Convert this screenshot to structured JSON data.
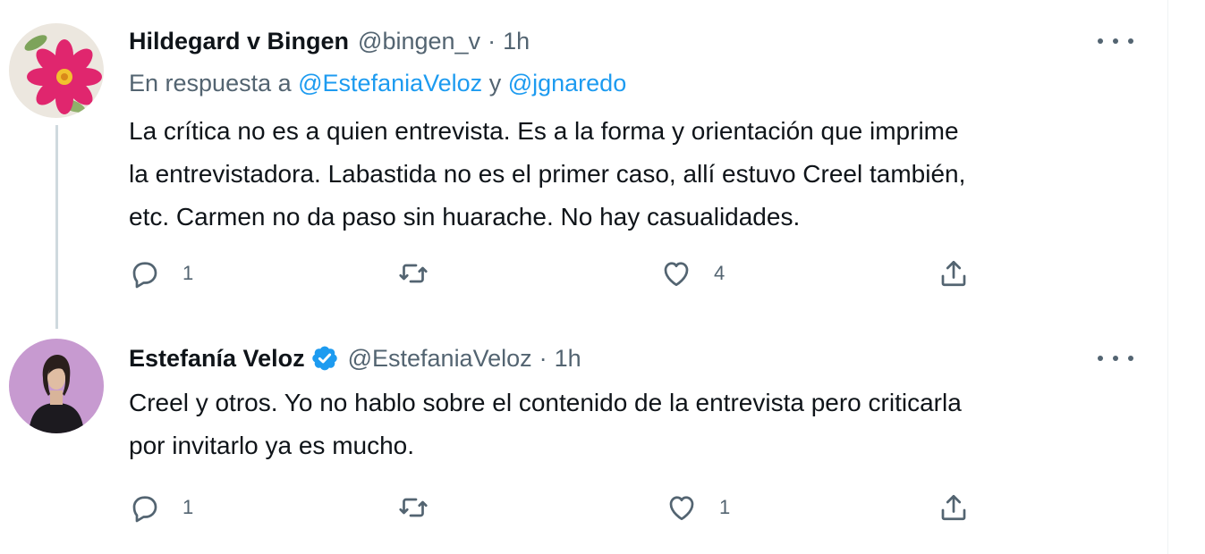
{
  "tweets": [
    {
      "name": "Hildegard v Bingen",
      "handle": "@bingen_v",
      "separator": "·",
      "time": "1h",
      "verified": false,
      "avatar_icon": "pink-flower-avatar",
      "reply_prefix": "En respuesta a",
      "reply_user_1": "@EstefaniaVeloz",
      "reply_joiner": "y",
      "reply_user_2": "@jgnaredo",
      "text_lines": [
        "La crítica no es a quien entrevista. Es a la forma y orientación que  imprime",
        "la entrevistadora. Labastida no es el primer caso, allí estuvo Creel también,",
        "etc. Carmen no da paso sin huarache. No hay casualidades."
      ],
      "reply_count": "1",
      "retweet_count": "",
      "like_count": "4"
    },
    {
      "name": "Estefanía Veloz",
      "handle": "@EstefaniaVeloz",
      "separator": "·",
      "time": "1h",
      "verified": true,
      "avatar_icon": "woman-portrait-avatar",
      "text_lines": [
        "Creel y otros. Yo no hablo sobre el contenido de la entrevista pero criticarla",
        "por invitarlo ya es mucho."
      ],
      "reply_count": "1",
      "retweet_count": "",
      "like_count": "1"
    }
  ],
  "colors": {
    "link": "#1d9bf0",
    "secondary_text": "#536471",
    "primary_text": "#0f1419",
    "verified_badge": "#1d9bf0",
    "thread_line": "#cfd9de"
  },
  "icons": {
    "reply": "reply-icon",
    "retweet": "retweet-icon",
    "like": "heart-icon",
    "share": "share-icon",
    "more": "more-options-icon"
  }
}
